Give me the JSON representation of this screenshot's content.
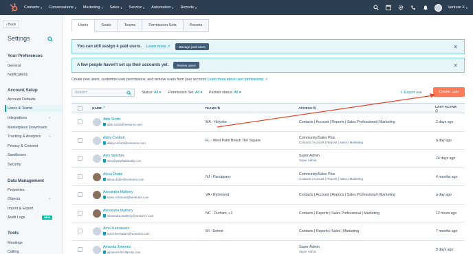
{
  "topnav": {
    "items": [
      "Contacts",
      "Conversations",
      "Marketing",
      "Sales",
      "Service",
      "Automation",
      "Reports"
    ],
    "account": "Venture X"
  },
  "sidebar": {
    "back": "Back",
    "title": "Settings",
    "sections": [
      {
        "title": "Your Preferences",
        "items": [
          "General",
          "Notifications"
        ]
      },
      {
        "title": "Account Setup",
        "items": [
          "Account Defaults",
          "Users & Teams",
          "Integrations",
          "Marketplace Downloads",
          "Tracking & Analytics",
          "Privacy & Consent",
          "Sandboxes",
          "Security"
        ]
      },
      {
        "title": "Data Management",
        "items": [
          "Properties",
          "Objects",
          "Import & Export",
          "Audit Logs"
        ]
      },
      {
        "title": "Tools",
        "items": [
          "Meetings",
          "Calling"
        ]
      }
    ],
    "new_badge": "NEW"
  },
  "tabs": [
    "Users",
    "Seats",
    "Teams",
    "Permission Sets",
    "Presets"
  ],
  "banner1": {
    "text": "You can still assign 4 paid users.",
    "link": "Learn more",
    "button": "Manage paid users"
  },
  "banner2": {
    "text": "A few people haven't set up their accounts yet.",
    "button": "Review users"
  },
  "helper": {
    "text": "Create new users, customize user permissions, and remove users from your account.",
    "link": "Learn more about user permissions"
  },
  "search": {
    "placeholder": "Search"
  },
  "filters": {
    "status_label": "Status:",
    "status_value": "All",
    "perm_label": "Permission Set:",
    "perm_value": "All",
    "partner_label": "Partner status:",
    "partner_value": "All"
  },
  "export": "Export use",
  "create_user": "Create user",
  "table": {
    "headers": {
      "name": "NAME",
      "teams": "TEAMS",
      "access": "ACCESS",
      "last_active": "LAST ACTIVE"
    },
    "rows": [
      {
        "name": "Abbi Smith",
        "email": "abbi.smith@venturex.com",
        "team": "MA - Holyoke",
        "access": "Contacts | Account | Reports | Sales Professional | Marketing",
        "access_sub": "",
        "last": "2 days ago"
      },
      {
        "name": "Abby Conforti",
        "email": "abby.conforti@venturex.com",
        "team": "FL - West Palm Beach The Square",
        "access": "Community/Sales Plus",
        "access_sub": "Contacts | Account | Reports | Sales | Marketing",
        "last": "a day ago"
      },
      {
        "name": "Alex Sinishin",
        "email": "alex@westfieldrealty.com",
        "team": "",
        "access": "Super Admin",
        "access_sub": "Super Admin",
        "last": "24 days ago"
      },
      {
        "name": "Alexa Drake",
        "email": "alexa.drake@venturex.com",
        "team": "NJ - Parsippany",
        "access": "Community/Sales Plus",
        "access_sub": "Contacts | Account | Reports | Sales | Marketing",
        "last": "4 months ago"
      },
      {
        "name": "Alexandra Mathery",
        "email": "sales.richmond@venturex.com",
        "team": "VA - Richmond",
        "access": "Contacts | Account | Reports | Sales Professional | Marketing",
        "access_sub": "",
        "last": "a day ago"
      },
      {
        "name": "Alexandra Mathery",
        "email": "alexandra.mathery@venturex.com",
        "team": "NC - Durham, +1",
        "access": "Contacts | Reports | Sales Professional | Marketing",
        "access_sub": "",
        "last": "12 hours ago"
      },
      {
        "name": "Amol Keerawani",
        "email": "amol.keerawani@venturex.com",
        "team": "MI - Detroit",
        "access": "Contacts | Reports | Sales | Marketing",
        "access_sub": "",
        "last": "7 months ago"
      },
      {
        "name": "Amanda Jimenez",
        "email": "ajimenez@cdfgcorp.com",
        "team": "",
        "access": "Super Admin",
        "access_sub": "Super Admin",
        "last": "8 days ago"
      }
    ]
  },
  "colors": {
    "nav": "#2d3e50",
    "accent": "#ff7a59",
    "link": "#0091ae",
    "arrow": "#e8472b"
  }
}
